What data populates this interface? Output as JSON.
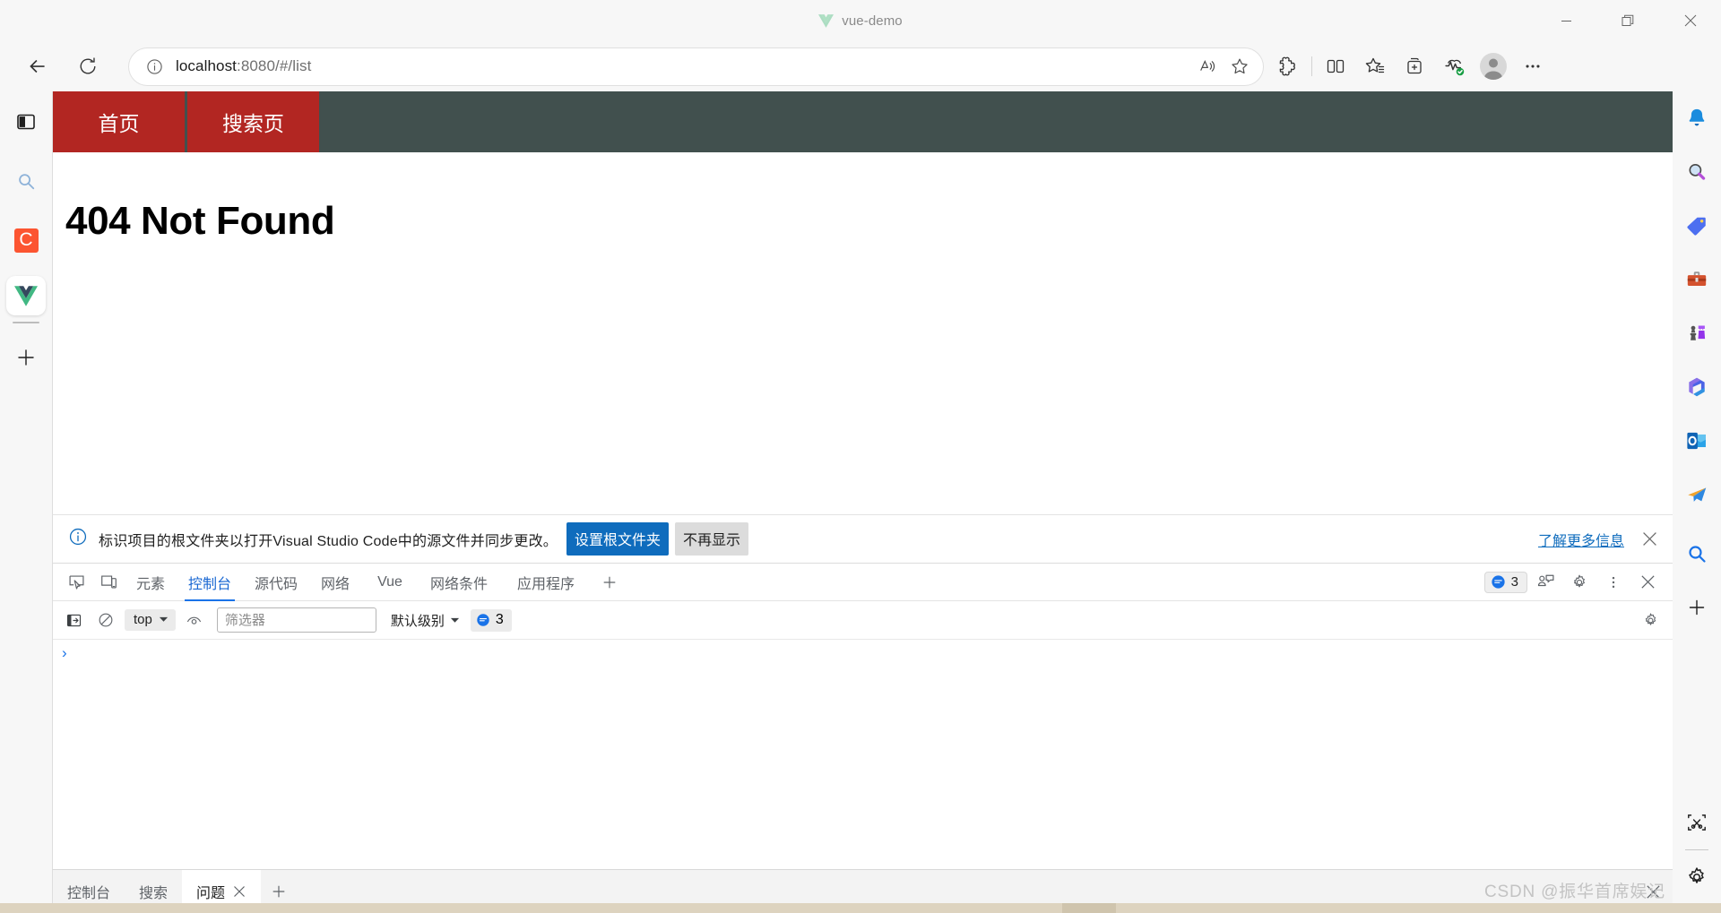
{
  "window": {
    "title": "vue-demo",
    "logo_icon": "vue-logo-icon",
    "minimize_label": "最小化",
    "maximize_label": "还原",
    "close_label": "关闭"
  },
  "browser": {
    "back_icon": "back-arrow-icon",
    "reload_icon": "reload-icon",
    "omnibox": {
      "info_icon": "site-info-icon",
      "url_prefix": "localhost",
      "url_rest": ":8080/#/list",
      "full_url": "localhost:8080/#/list",
      "read_aloud_icon": "read-aloud-icon",
      "favorite_icon": "favorite-star-icon"
    },
    "actions": [
      {
        "name": "extensions-icon",
        "label": "扩展"
      },
      {
        "name": "split-screen-icon",
        "label": "拆分屏幕"
      },
      {
        "name": "favorites-icon",
        "label": "收藏夹"
      },
      {
        "name": "collections-icon",
        "label": "集锦"
      },
      {
        "name": "browser-essentials-icon",
        "label": "浏览器基本信息"
      },
      {
        "name": "profile-avatar",
        "label": "个人资料"
      },
      {
        "name": "settings-more-icon",
        "label": "设置及其他"
      }
    ]
  },
  "left_sidebar": {
    "items": [
      {
        "name": "sidebar-split-pane-icon",
        "label": "拆分窗格"
      },
      {
        "name": "sidebar-search-icon",
        "label": "搜索"
      },
      {
        "name": "sidebar-csdn-icon",
        "label": "C"
      },
      {
        "name": "sidebar-vue-tab-icon",
        "label": "vue-demo"
      },
      {
        "name": "sidebar-add-icon",
        "label": "新建"
      }
    ]
  },
  "right_sidebar": {
    "items": [
      {
        "name": "notifications-bell-icon",
        "label": "通知"
      },
      {
        "name": "bing-search-icon",
        "label": "搜索"
      },
      {
        "name": "shopping-tag-icon",
        "label": "购物"
      },
      {
        "name": "toolbox-icon",
        "label": "工具"
      },
      {
        "name": "games-chess-icon",
        "label": "游戏"
      },
      {
        "name": "microsoft-365-icon",
        "label": "Microsoft 365"
      },
      {
        "name": "outlook-icon",
        "label": "Outlook"
      },
      {
        "name": "send-paperplane-icon",
        "label": "发送"
      },
      {
        "name": "search-blue-icon",
        "label": "搜索"
      },
      {
        "name": "add-tool-icon",
        "label": "添加"
      },
      {
        "name": "web-capture-icon",
        "label": "Web 捕获"
      },
      {
        "name": "sidebar-settings-icon",
        "label": "设置"
      }
    ]
  },
  "page": {
    "nav_tabs": [
      {
        "label": "首页"
      },
      {
        "label": "搜索页"
      }
    ],
    "heading": "404 Not Found",
    "nav_bg": "#41504e",
    "nav_tab_bg": "#b22622"
  },
  "notification": {
    "info_icon": "info-circle-icon",
    "message": "标识项目的根文件夹以打开Visual Studio Code中的源文件并同步更改。",
    "primary_button": "设置根文件夹",
    "secondary_button": "不再显示",
    "learn_more": "了解更多信息",
    "close_icon": "close-icon",
    "primary_color": "#0f6cbd"
  },
  "devtools": {
    "inspect_icon": "inspect-element-icon",
    "device_toolbar_icon": "device-toolbar-icon",
    "tabs": [
      {
        "label": "元素",
        "active": false
      },
      {
        "label": "控制台",
        "active": true
      },
      {
        "label": "源代码",
        "active": false
      },
      {
        "label": "网络",
        "active": false
      },
      {
        "label": "Vue",
        "active": false
      },
      {
        "label": "网络条件",
        "active": false
      },
      {
        "label": "应用程序",
        "active": false
      }
    ],
    "add_tab_icon": "add-panel-icon",
    "message_count": "3",
    "message_icon": "message-bubble-icon",
    "feedback_icon": "feedback-icon",
    "settings_icon": "gear-icon",
    "more_icon": "more-vertical-icon",
    "close_icon": "close-icon",
    "console_toolbar": {
      "sidebar_icon": "console-sidebar-icon",
      "clear_icon": "clear-console-icon",
      "context": "top",
      "eye_icon": "live-expression-icon",
      "filter_placeholder": "筛选器",
      "filter_value": "",
      "level": "默认级别",
      "count": "3",
      "settings_icon": "gear-icon"
    },
    "prompt_caret": "›"
  },
  "drawer": {
    "tabs": [
      {
        "label": "控制台",
        "active": false,
        "closable": false
      },
      {
        "label": "搜索",
        "active": false,
        "closable": false
      },
      {
        "label": "问题",
        "active": true,
        "closable": true
      }
    ],
    "add_tab_icon": "add-panel-icon",
    "close_icon": "close-drawer-icon"
  },
  "watermark": "CSDN @振华首席娱记"
}
